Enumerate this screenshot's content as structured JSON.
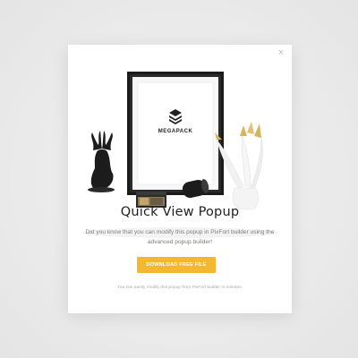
{
  "popup": {
    "close_glyph": "×",
    "title": "Quick View Popup",
    "description": "Did you know that you can modify this popup in PixFort builder using the advanced popup builder!",
    "cta_label": "DOWNLOAD FREE FILE",
    "footnote": "You can easily modify this popup from PixFort builder in minutes.",
    "frame_logo_text": "MEGAPACK"
  },
  "colors": {
    "accent": "#f4b731",
    "title": "#1f1f1f",
    "text": "#7c7c7c",
    "background": "#ebebeb"
  },
  "icons": {
    "close": "close-icon",
    "logo": "cube-logo-icon"
  }
}
